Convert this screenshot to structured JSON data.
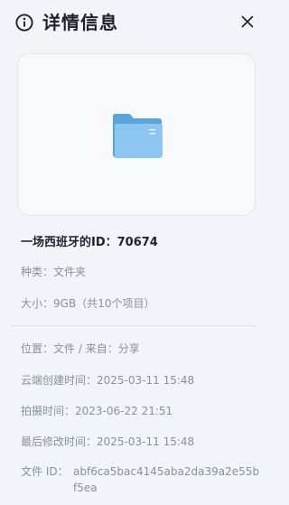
{
  "header": {
    "title": "详情信息",
    "icon": "info-circle-icon",
    "close_icon": "close-icon"
  },
  "preview": {
    "icon": "folder-icon",
    "colors": {
      "folder_back": "#5aa5dd",
      "folder_front": "#8ec6f2",
      "card_bg": "#f8f9fb"
    }
  },
  "item": {
    "name": "一场西班牙的ID：70674"
  },
  "details": {
    "kind_label": "种类：",
    "kind_value": "文件夹",
    "size_label": "大小：",
    "size_value": "9GB（共10个项目）",
    "location_label": "位置：",
    "location_value": "文件 / 来自：分享",
    "cloud_created_label": "云端创建时间：",
    "cloud_created_value": "2025-03-11 15:48",
    "shot_label": "拍摄时间：",
    "shot_value": "2023-06-22 21:51",
    "modified_label": "最后修改时间：",
    "modified_value": "2025-03-11 15:48",
    "file_id_label": "文件 ID：",
    "file_id_value": "abf6ca5bac4145aba2da39a2e55bf5ea"
  }
}
